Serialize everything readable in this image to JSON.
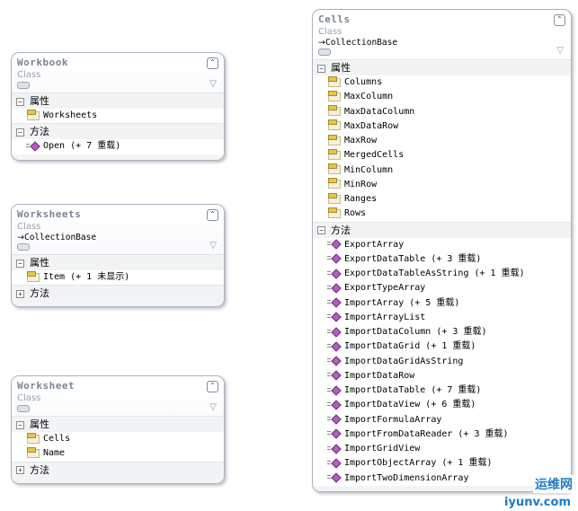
{
  "classes": [
    {
      "name": "Workbook",
      "kind": "Class",
      "base": "",
      "sections": [
        {
          "label": "属性",
          "expanded": true,
          "members": [
            {
              "type": "property",
              "text": "Worksheets"
            }
          ]
        },
        {
          "label": "方法",
          "expanded": true,
          "members": [
            {
              "type": "method",
              "text": "Open (+ 7 重载)"
            }
          ]
        }
      ]
    },
    {
      "name": "Worksheets",
      "kind": "Class",
      "base": "CollectionBase",
      "sections": [
        {
          "label": "属性",
          "expanded": true,
          "members": [
            {
              "type": "property",
              "text": "Item (+ 1 未显示)"
            }
          ]
        },
        {
          "label": "方法",
          "expanded": false,
          "members": []
        }
      ]
    },
    {
      "name": "Worksheet",
      "kind": "Class",
      "base": "",
      "sections": [
        {
          "label": "属性",
          "expanded": true,
          "members": [
            {
              "type": "property",
              "text": "Cells"
            },
            {
              "type": "property",
              "text": "Name"
            }
          ]
        },
        {
          "label": "方法",
          "expanded": false,
          "members": []
        }
      ]
    },
    {
      "name": "Cells",
      "kind": "Class",
      "base": "CollectionBase",
      "sections": [
        {
          "label": "属性",
          "expanded": true,
          "members": [
            {
              "type": "property",
              "text": "Columns"
            },
            {
              "type": "property",
              "text": "MaxColumn"
            },
            {
              "type": "property",
              "text": "MaxDataColumn"
            },
            {
              "type": "property",
              "text": "MaxDataRow"
            },
            {
              "type": "property",
              "text": "MaxRow"
            },
            {
              "type": "property",
              "text": "MergedCells"
            },
            {
              "type": "property",
              "text": "MinColumn"
            },
            {
              "type": "property",
              "text": "MinRow"
            },
            {
              "type": "property",
              "text": "Ranges"
            },
            {
              "type": "property",
              "text": "Rows"
            }
          ]
        },
        {
          "label": "方法",
          "expanded": true,
          "members": [
            {
              "type": "method",
              "text": "ExportArray"
            },
            {
              "type": "method",
              "text": "ExportDataTable (+ 3 重载)"
            },
            {
              "type": "method",
              "text": "ExportDataTableAsString (+ 1 重载)"
            },
            {
              "type": "method",
              "text": "ExportTypeArray"
            },
            {
              "type": "method",
              "text": "ImportArray (+ 5 重载)"
            },
            {
              "type": "method",
              "text": "ImportArrayList"
            },
            {
              "type": "method",
              "text": "ImportDataColumn (+ 3 重载)"
            },
            {
              "type": "method",
              "text": "ImportDataGrid (+ 1 重载)"
            },
            {
              "type": "method",
              "text": "ImportDataGridAsString"
            },
            {
              "type": "method",
              "text": "ImportDataRow"
            },
            {
              "type": "method",
              "text": "ImportDataTable (+ 7 重载)"
            },
            {
              "type": "method",
              "text": "ImportDataView (+ 6 重载)"
            },
            {
              "type": "method",
              "text": "ImportFormulaArray"
            },
            {
              "type": "method",
              "text": "ImportFromDataReader (+ 3 重载)"
            },
            {
              "type": "method",
              "text": "ImportGridView"
            },
            {
              "type": "method",
              "text": "ImportObjectArray (+ 1 重载)"
            },
            {
              "type": "method",
              "text": "ImportTwoDimensionArray"
            }
          ]
        }
      ]
    }
  ],
  "watermark": {
    "text": "运维网",
    "url": "iyunv.com"
  }
}
